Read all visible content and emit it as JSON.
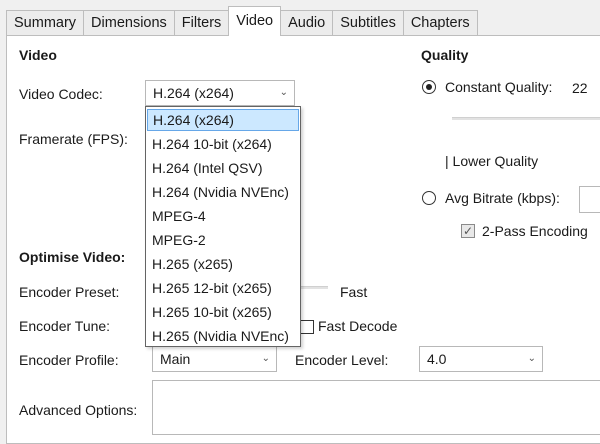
{
  "tabs": [
    "Summary",
    "Dimensions",
    "Filters",
    "Video",
    "Audio",
    "Subtitles",
    "Chapters"
  ],
  "active_tab": "Video",
  "video": {
    "heading": "Video",
    "codec_label": "Video Codec:",
    "codec_value": "H.264 (x264)",
    "framerate_label": "Framerate (FPS):"
  },
  "codec_options": [
    "H.264 (x264)",
    "H.264 10-bit (x264)",
    "H.264 (Intel QSV)",
    "H.264 (Nvidia NVEnc)",
    "MPEG-4",
    "MPEG-2",
    "H.265 (x265)",
    "H.265 12-bit (x265)",
    "H.265 10-bit (x265)",
    "H.265 (Nvidia NVEnc)"
  ],
  "quality": {
    "heading": "Quality",
    "constant_label": "Constant Quality:",
    "constant_value": "22",
    "lower_quality_label": "| Lower Quality",
    "avg_bitrate_label": "Avg Bitrate (kbps):",
    "two_pass_label": "2-Pass Encoding"
  },
  "optimise": {
    "heading": "Optimise Video:",
    "preset_label": "Encoder Preset:",
    "preset_value": "Fast",
    "tune_label": "Encoder Tune:",
    "fast_decode_label": "Fast Decode",
    "profile_label": "Encoder Profile:",
    "profile_value": "Main",
    "level_label": "Encoder Level:",
    "level_value": "4.0",
    "advanced_label": "Advanced Options:"
  },
  "icons": {
    "dropdown_arrow": "chevron-down-icon",
    "check": "checkmark-icon"
  }
}
